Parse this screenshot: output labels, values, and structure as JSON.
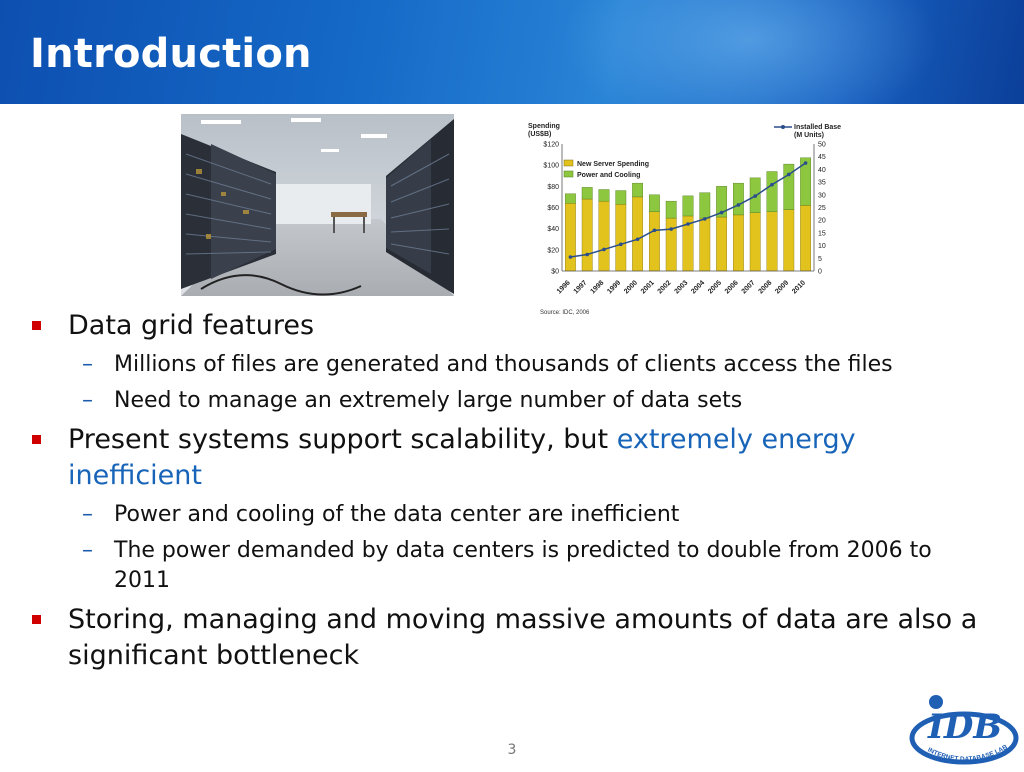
{
  "slide": {
    "title": "Introduction",
    "page_number": "3"
  },
  "bullets": [
    {
      "text": "Data grid features",
      "sub": [
        "Millions of files are generated and thousands of clients access the files",
        "Need to manage an extremely large number of data sets"
      ]
    },
    {
      "text_plain": "Present systems support scalability, but ",
      "text_highlight": "extremely energy inefficient",
      "sub": [
        "Power and cooling of the data center are inefficient",
        "The power demanded by data centers is predicted to double from 2006 to 2011"
      ]
    },
    {
      "text": "Storing, managing and moving massive amounts of data are also a significant bottleneck",
      "sub": []
    }
  ],
  "logo": {
    "text": "IDB",
    "ring_text": "INTERNET DATABASE LAB"
  },
  "colors": {
    "title_bar": "#1569c7",
    "bullet_marker": "#d00000",
    "highlight_text": "#1764b8",
    "bar_yellow": "#e2c21c",
    "bar_green": "#8dc63f",
    "line_blue": "#2a4e8c"
  },
  "chart_data": {
    "type": "bar",
    "title": "",
    "left_axis_label": "Spending (US$B)",
    "right_axis_label": "Installed Base (M Units)",
    "source": "Source: IDC, 2006",
    "categories": [
      "1996",
      "1997",
      "1998",
      "1999",
      "2000",
      "2001",
      "2002",
      "2003",
      "2004",
      "2005",
      "2006",
      "2007",
      "2008",
      "2009",
      "2010"
    ],
    "ylim_left": [
      0,
      120
    ],
    "ylim_right": [
      0,
      50
    ],
    "left_ticks": [
      "$0",
      "$20",
      "$40",
      "$60",
      "$80",
      "$100",
      "$120"
    ],
    "right_ticks": [
      "0",
      "5",
      "10",
      "15",
      "20",
      "25",
      "30",
      "35",
      "40",
      "45",
      "50"
    ],
    "series": [
      {
        "name": "New Server Spending",
        "kind": "stacked-bar",
        "values": [
          64,
          68,
          66,
          63,
          70,
          56,
          50,
          52,
          50,
          51,
          53,
          55,
          56,
          58,
          62
        ]
      },
      {
        "name": "Power and Cooling",
        "kind": "stacked-bar",
        "values": [
          9,
          11,
          11,
          13,
          13,
          16,
          16,
          19,
          24,
          29,
          30,
          33,
          38,
          43,
          45
        ]
      },
      {
        "name": "Installed Base",
        "kind": "line",
        "axis": "right",
        "values": [
          5.5,
          6.5,
          8.5,
          10.5,
          12.5,
          16,
          16.5,
          18.5,
          20.5,
          23,
          26,
          29.5,
          34,
          38,
          42.5
        ]
      }
    ]
  }
}
